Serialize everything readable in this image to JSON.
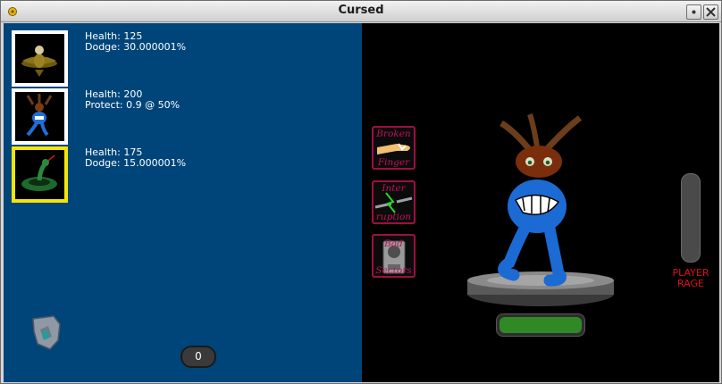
{
  "window": {
    "title": "Cursed"
  },
  "party": [
    {
      "health": "Health: 125",
      "ability": "Dodge: 30.000001%",
      "selected": false,
      "icon": "golden-bird"
    },
    {
      "health": "Health: 200",
      "ability": "Protect: 0.9 @ 50%",
      "selected": false,
      "icon": "blue-imp"
    },
    {
      "health": "Health: 175",
      "ability": "Dodge: 15.000001%",
      "selected": true,
      "icon": "green-snake"
    }
  ],
  "counter": "0",
  "cards": [
    {
      "line1": "Broken",
      "line2": "Finger"
    },
    {
      "line1": "Inter",
      "line2": "ruption"
    },
    {
      "line1": "Bad",
      "line2": "Sectors"
    }
  ],
  "rage": {
    "label_line1": "PLAYER",
    "label_line2": "RAGE",
    "level": 0
  },
  "player_health": {
    "level": 1.0
  },
  "colors": {
    "left_panel": "#00457a",
    "right_panel": "#000000",
    "selected_border": "#f5e40a",
    "card_border": "#9c1040",
    "rage_text": "#d8101d",
    "health_fill": "#2f8a26"
  }
}
